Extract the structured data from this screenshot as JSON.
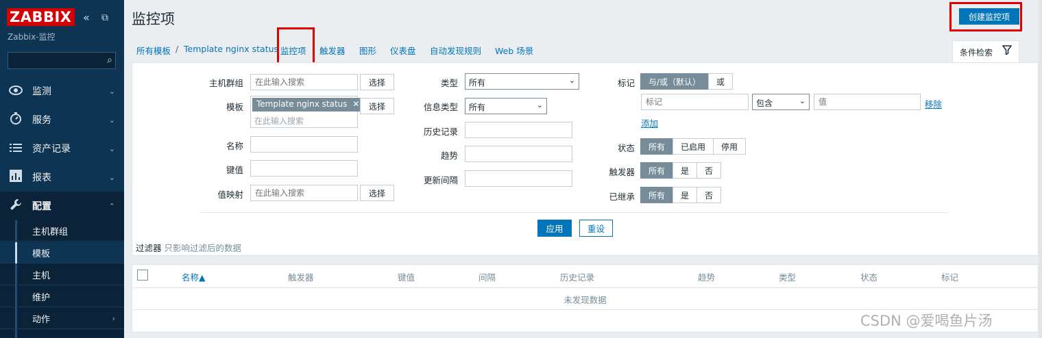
{
  "sidebar": {
    "logo": "ZABBIX",
    "subtitle": "Zabbix-监控",
    "collapse_icon": "«",
    "expand_icon": "⧉",
    "search_icon": "⌕",
    "menu": [
      {
        "label": "监测",
        "icon": "eye-icon"
      },
      {
        "label": "服务",
        "icon": "clock-icon"
      },
      {
        "label": "资产记录",
        "icon": "list-icon"
      },
      {
        "label": "报表",
        "icon": "chart-icon"
      },
      {
        "label": "配置",
        "icon": "wrench-icon"
      }
    ],
    "submenu": [
      "主机群组",
      "模板",
      "主机",
      "维护",
      "动作"
    ]
  },
  "header": {
    "title": "监控项",
    "create_label": "创建监控项"
  },
  "nav": {
    "all_templates": "所有模板",
    "separator": "/",
    "template": "Template nginx status",
    "items": "监控项",
    "triggers": "触发器",
    "graphs": "图形",
    "dashboards": "仪表盘",
    "discovery": "自动发现规则",
    "web": "Web 场景",
    "filter_tab": "条件检索"
  },
  "filter": {
    "host_group_label": "主机群组",
    "host_group_placeholder": "在此输入搜索",
    "select_label": "选择",
    "template_label": "模板",
    "template_chip": "Template nginx status",
    "template_placeholder": "在此输入搜索",
    "name_label": "名称",
    "key_label": "键值",
    "valuemap_label": "值映射",
    "valuemap_placeholder": "在此输入搜索",
    "type_label": "类型",
    "type_value": "所有",
    "info_type_label": "信息类型",
    "info_type_value": "所有",
    "history_label": "历史记录",
    "trends_label": "趋势",
    "interval_label": "更新间隔",
    "tags_label": "标记",
    "tags_and_or": "与/或（默认）",
    "tags_or": "或",
    "tag_placeholder": "标记",
    "tag_op": "包含",
    "tag_value_placeholder": "值",
    "remove": "移除",
    "add": "添加",
    "state_label": "状态",
    "state_opts": [
      "所有",
      "已启用",
      "停用"
    ],
    "triggers_label": "触发器",
    "triggers_opts": [
      "所有",
      "是",
      "否"
    ],
    "inherited_label": "已继承",
    "inherited_opts": [
      "所有",
      "是",
      "否"
    ],
    "apply": "应用",
    "reset": "重设",
    "note_prefix": "过滤器",
    "note_text": "只影响过滤后的数据"
  },
  "table": {
    "columns": [
      "名称▲",
      "触发器",
      "键值",
      "间隔",
      "历史记录",
      "趋势",
      "类型",
      "状态",
      "标记"
    ],
    "empty": "未发现数据"
  },
  "watermark": "CSDN @爱喝鱼片汤"
}
